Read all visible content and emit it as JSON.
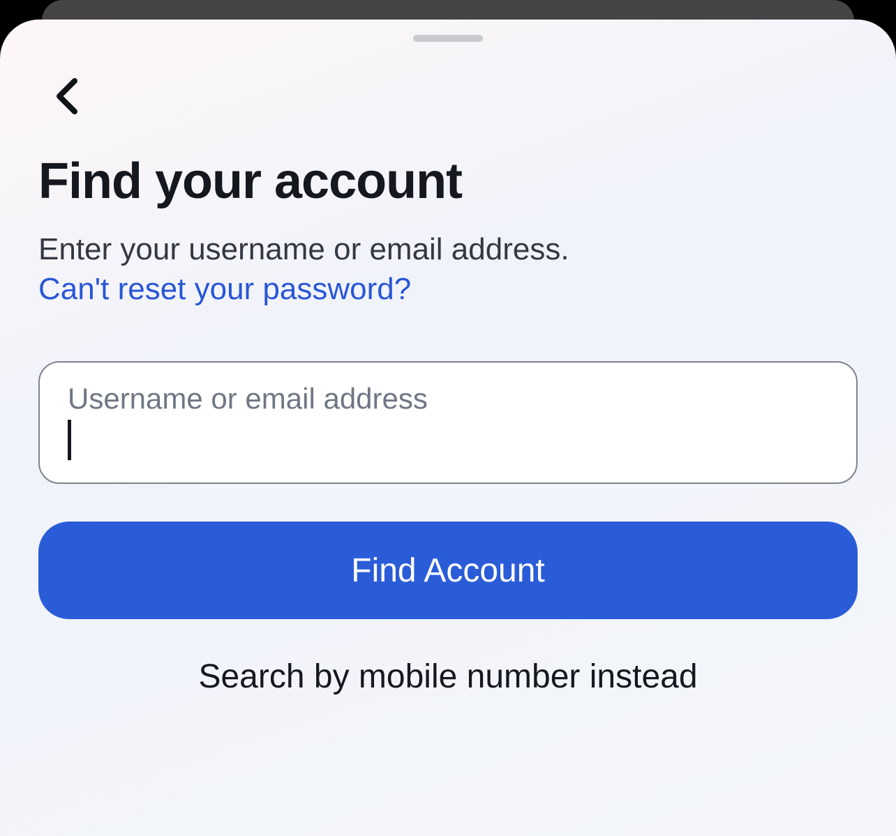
{
  "page": {
    "title": "Find your account",
    "subtitle": "Enter your username or email address.",
    "help_link": "Can't reset your password?"
  },
  "input": {
    "label": "Username or email address",
    "value": ""
  },
  "actions": {
    "primary": "Find Account",
    "secondary": "Search by mobile number instead"
  }
}
